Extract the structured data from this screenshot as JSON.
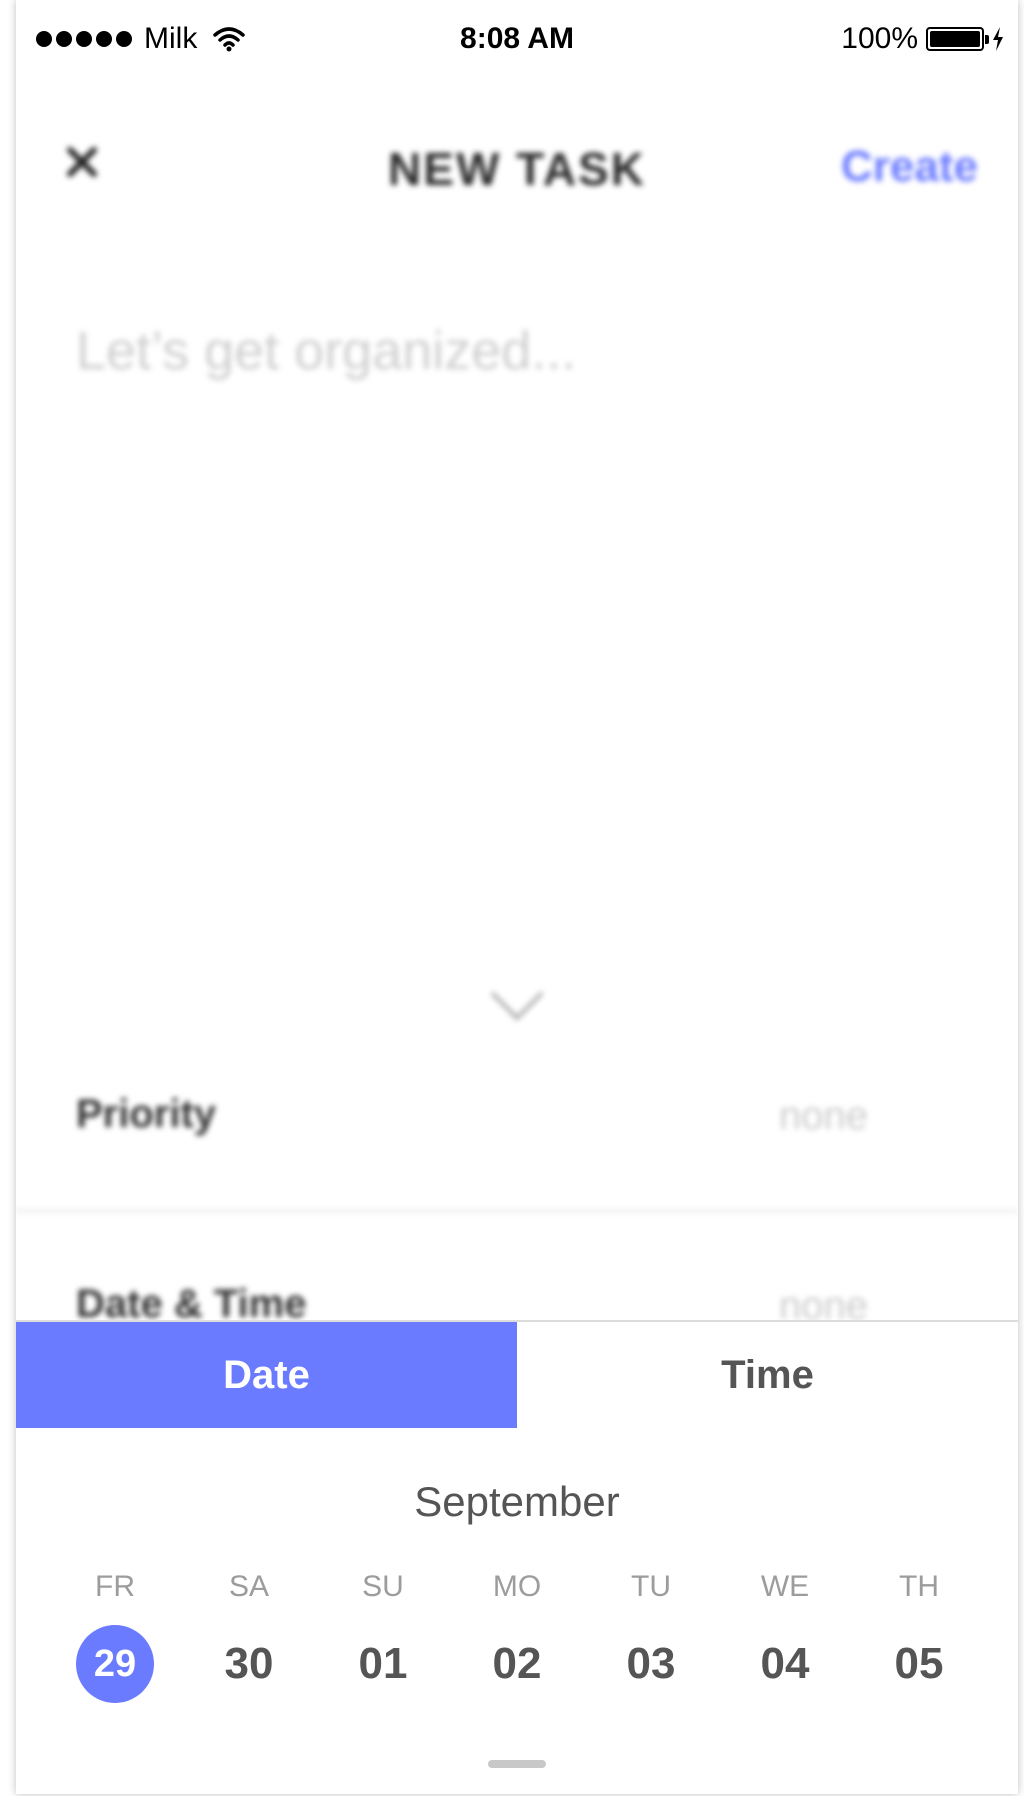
{
  "status_bar": {
    "carrier": "Milk",
    "time": "8:08 AM",
    "battery": "100%"
  },
  "nav": {
    "title": "NEW TASK",
    "create_label": "Create"
  },
  "task_input": {
    "placeholder": "Let’s get organized..."
  },
  "rows": {
    "priority_label": "Priority",
    "priority_value": "none",
    "datetime_label": "Date & Time",
    "datetime_value": "none"
  },
  "picker": {
    "tabs": [
      {
        "label": "Date",
        "active": true
      },
      {
        "label": "Time",
        "active": false
      }
    ],
    "month": "September",
    "weekdays": [
      "FR",
      "SA",
      "SU",
      "MO",
      "TU",
      "WE",
      "TH"
    ],
    "days": [
      "29",
      "30",
      "01",
      "02",
      "03",
      "04",
      "05"
    ],
    "selected_day": "29"
  },
  "colors": {
    "accent": "#6b7bff",
    "text_dark": "#555555",
    "text_muted": "#9c9c9c"
  }
}
